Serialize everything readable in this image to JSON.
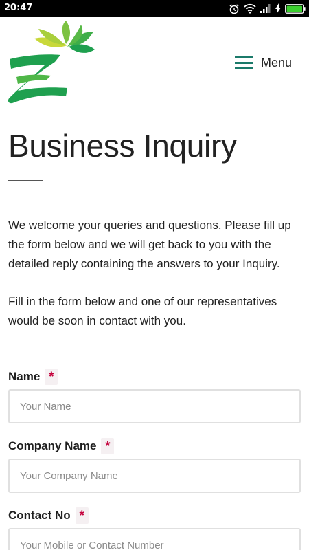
{
  "status_bar": {
    "time": "20:47"
  },
  "header": {
    "menu_label": "Menu",
    "brand_colors": [
      "#1fa04f",
      "#7cc242",
      "#c8d83a"
    ],
    "accent_color": "#1b7a6a"
  },
  "page": {
    "title": "Business Inquiry",
    "intro_paragraphs": [
      "We welcome your queries and questions. Please fill up the form below and we will get back to you with the detailed reply containing the answers to your Inquiry.",
      "Fill in the form below and one of our representatives would be soon in contact with you."
    ]
  },
  "form": {
    "required_marker": "*",
    "fields": [
      {
        "label": "Name",
        "placeholder": "Your Name",
        "value": ""
      },
      {
        "label": "Company Name",
        "placeholder": "Your Company Name",
        "value": ""
      },
      {
        "label": "Contact No",
        "placeholder": "Your Mobile or Contact Number",
        "value": ""
      }
    ]
  }
}
